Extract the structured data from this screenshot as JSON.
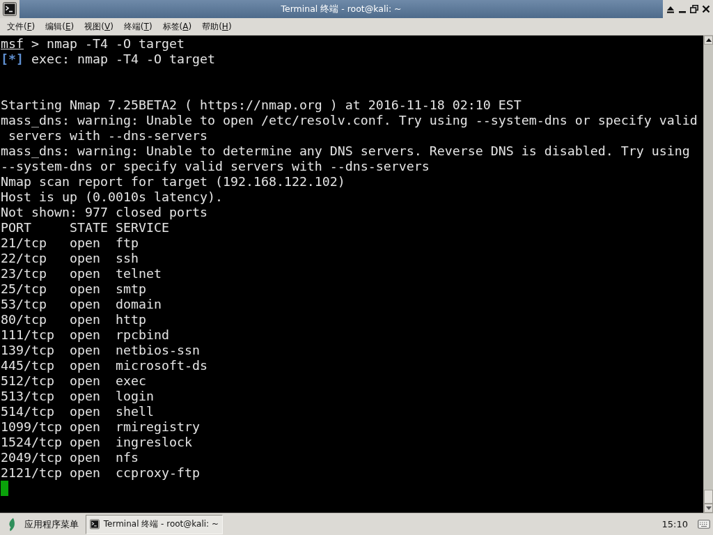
{
  "window": {
    "title": "Terminal 终端 - root@kali: ~"
  },
  "menu_bar": {
    "items": [
      "文件(F)",
      "编辑(E)",
      "视图(V)",
      "终端(T)",
      "标签(A)",
      "帮助(H)"
    ]
  },
  "terminal": {
    "lines": [
      {
        "kind": "prompt",
        "prompt": "msf",
        "text": "> nmap -T4 -O target"
      },
      {
        "kind": "status",
        "tag": "[*]",
        "text": "exec: nmap -T4 -O target"
      },
      {
        "kind": "blank"
      },
      {
        "kind": "blank"
      },
      {
        "kind": "output",
        "text": "Starting Nmap 7.25BETA2 ( https://nmap.org ) at 2016-11-18 02:10 EST"
      },
      {
        "kind": "output",
        "text": "mass_dns: warning: Unable to open /etc/resolv.conf. Try using --system-dns or specify valid"
      },
      {
        "kind": "output",
        "text": " servers with --dns-servers"
      },
      {
        "kind": "output",
        "text": "mass_dns: warning: Unable to determine any DNS servers. Reverse DNS is disabled. Try using"
      },
      {
        "kind": "output",
        "text": "--system-dns or specify valid servers with --dns-servers"
      },
      {
        "kind": "output",
        "text": "Nmap scan report for target (192.168.122.102)"
      },
      {
        "kind": "output",
        "text": "Host is up (0.0010s latency)."
      },
      {
        "kind": "output",
        "text": "Not shown: 977 closed ports"
      },
      {
        "kind": "table",
        "columns": [
          "PORT",
          "STATE",
          "SERVICE"
        ],
        "rows": [
          {
            "port": "21/tcp",
            "state": "open",
            "service": "ftp"
          },
          {
            "port": "22/tcp",
            "state": "open",
            "service": "ssh"
          },
          {
            "port": "23/tcp",
            "state": "open",
            "service": "telnet"
          },
          {
            "port": "25/tcp",
            "state": "open",
            "service": "smtp"
          },
          {
            "port": "53/tcp",
            "state": "open",
            "service": "domain"
          },
          {
            "port": "80/tcp",
            "state": "open",
            "service": "http"
          },
          {
            "port": "111/tcp",
            "state": "open",
            "service": "rpcbind"
          },
          {
            "port": "139/tcp",
            "state": "open",
            "service": "netbios-ssn"
          },
          {
            "port": "445/tcp",
            "state": "open",
            "service": "microsoft-ds"
          },
          {
            "port": "512/tcp",
            "state": "open",
            "service": "exec"
          },
          {
            "port": "513/tcp",
            "state": "open",
            "service": "login"
          },
          {
            "port": "514/tcp",
            "state": "open",
            "service": "shell"
          },
          {
            "port": "1099/tcp",
            "state": "open",
            "service": "rmiregistry"
          },
          {
            "port": "1524/tcp",
            "state": "open",
            "service": "ingreslock"
          },
          {
            "port": "2049/tcp",
            "state": "open",
            "service": "nfs"
          },
          {
            "port": "2121/tcp",
            "state": "open",
            "service": "ccproxy-ftp"
          }
        ]
      }
    ]
  },
  "taskbar": {
    "menu_label": "应用程序菜单",
    "tasks": [
      {
        "label": "Terminal 终端 - root@kali: ~",
        "selected": true
      }
    ],
    "clock": "15:10"
  }
}
